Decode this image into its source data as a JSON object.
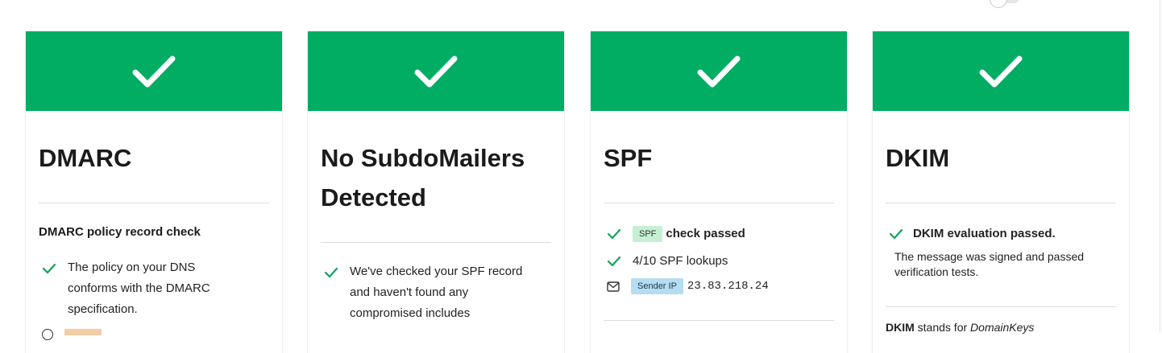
{
  "colors": {
    "header_green": "#00ad63",
    "check_green": "#10a35a",
    "badge_spf": "#c7efd4",
    "badge_ip": "#b5dcf1"
  },
  "cards": [
    {
      "title": "DMARC",
      "section_title": "DMARC policy record check",
      "items": [
        {
          "icon": "check-icon",
          "text": "The policy on your DNS conforms with the DMARC specification."
        }
      ]
    },
    {
      "title": "No SubdoMailers Detected",
      "items": [
        {
          "icon": "check-icon",
          "text": "We've checked your SPF record and haven't found any compromised includes"
        }
      ]
    },
    {
      "title": "SPF",
      "items": [
        {
          "icon": "check-icon",
          "badge": "SPF",
          "text": "check passed"
        },
        {
          "icon": "check-icon",
          "text": "4/10 SPF lookups"
        },
        {
          "icon": "envelope-icon",
          "badge": "Sender IP",
          "text": "23.83.218.24"
        }
      ]
    },
    {
      "title": "DKIM",
      "items": [
        {
          "icon": "check-icon",
          "text": "DKIM evaluation passed."
        }
      ],
      "description": "The message was signed and passed verification tests.",
      "footer_bold": "DKIM",
      "footer_text": "stands for",
      "footer_italic": "DomainKeys"
    }
  ]
}
